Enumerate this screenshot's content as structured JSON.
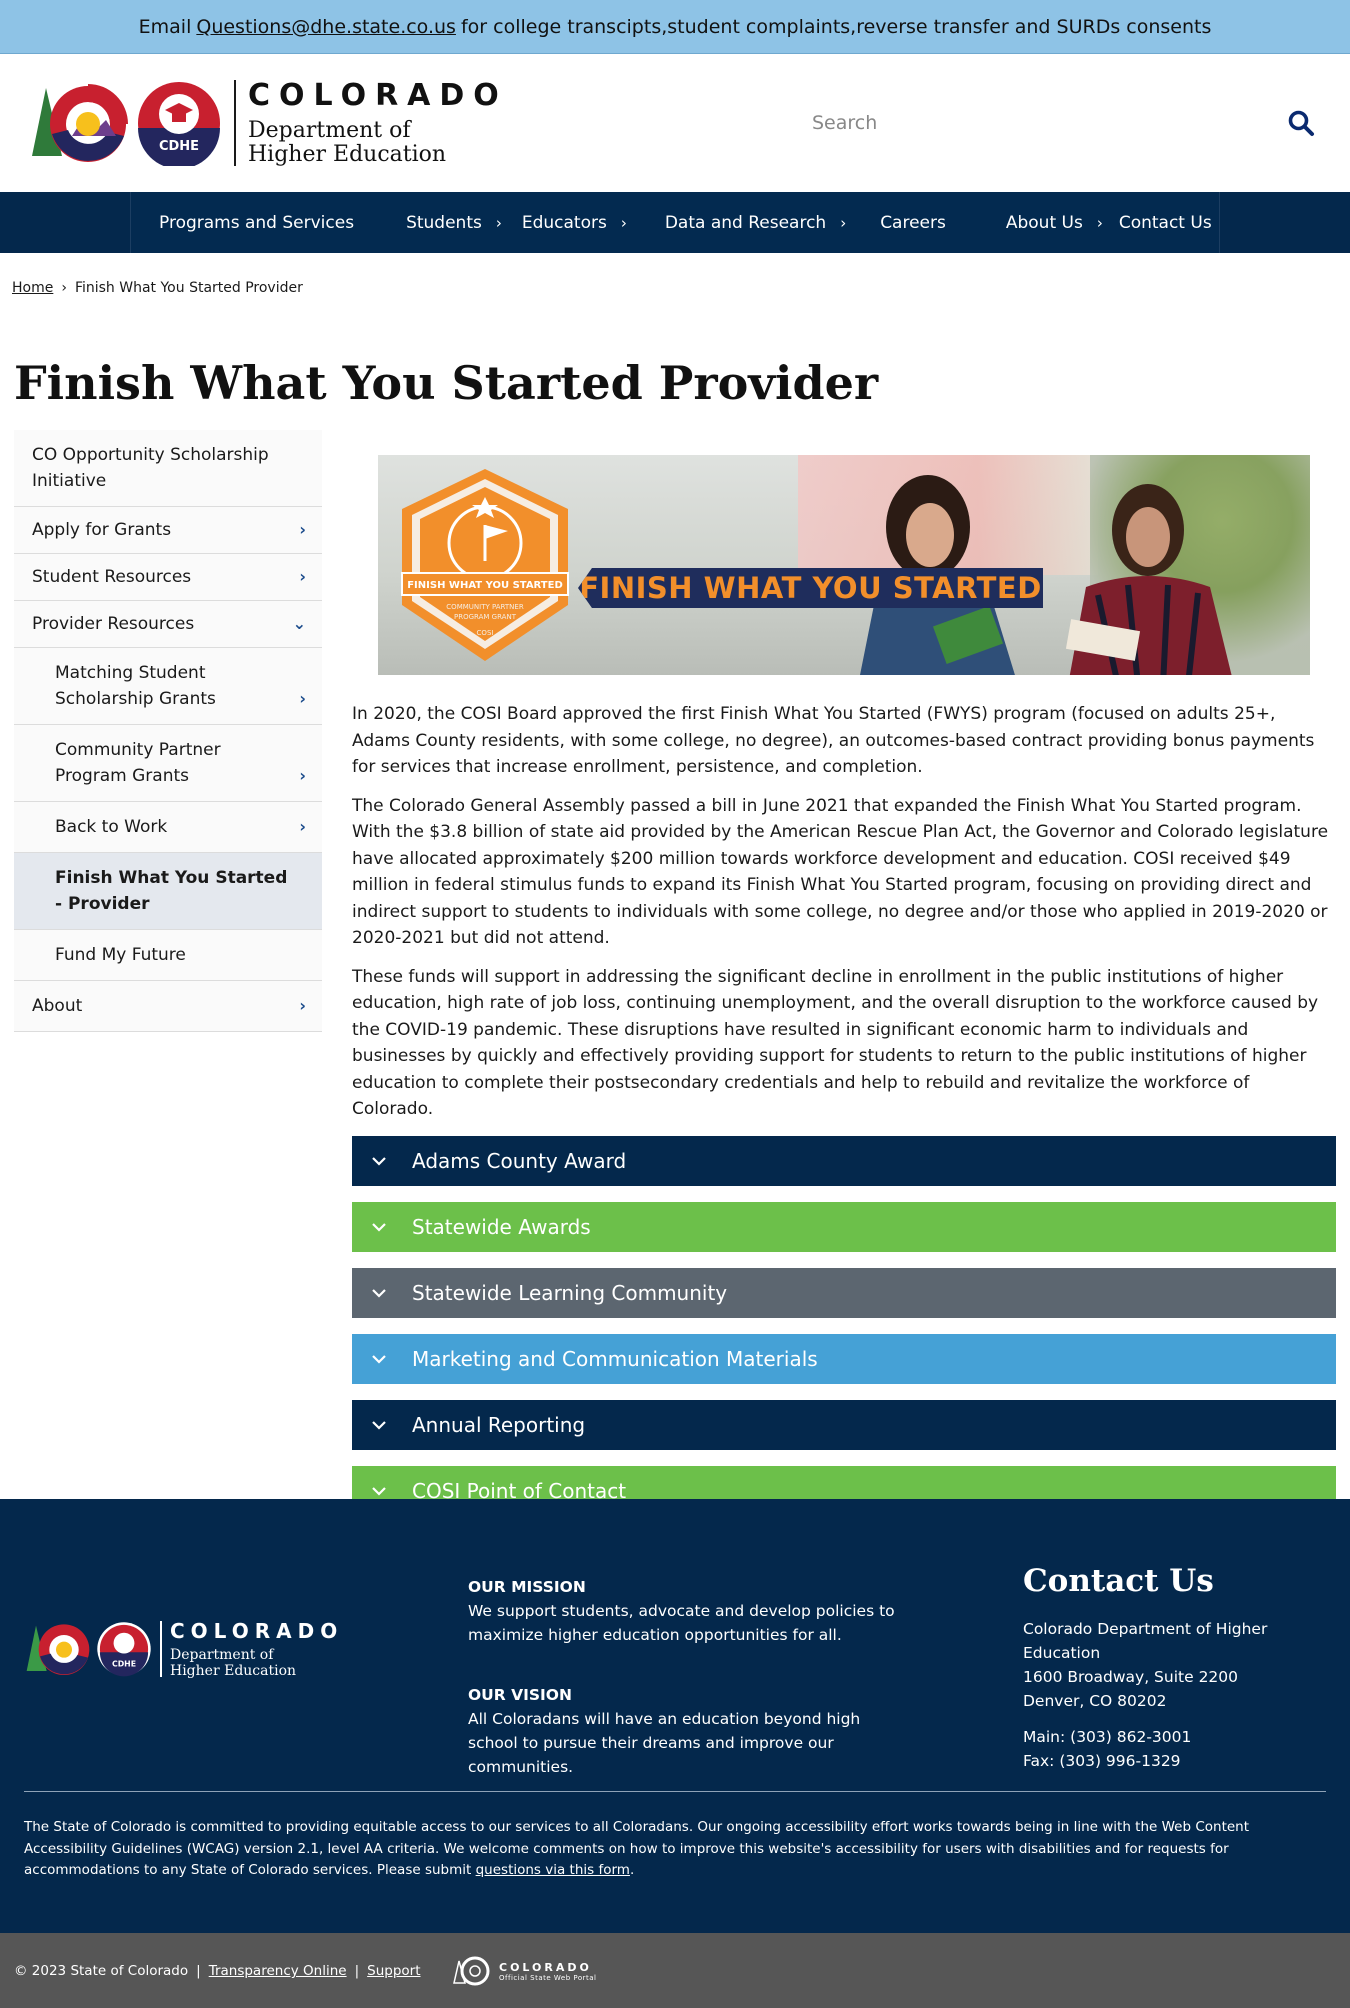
{
  "alert": {
    "prefix": "Email ",
    "link": "Questions@dhe.state.co.us",
    "suffix": " for college transcipts,student complaints,reverse transfer and SURDs consents"
  },
  "header": {
    "logo_state": "COLORADO",
    "logo_dept_line1": "Department of",
    "logo_dept_line2": "Higher Education",
    "logo_badge": "CDHE",
    "search_placeholder": "Search",
    "colors": {
      "brand_navy": "#04284c",
      "alert_bg": "#8ec3e6"
    }
  },
  "nav": {
    "items": [
      {
        "label": "Programs and Services",
        "has_chevron": false
      },
      {
        "label": "Students",
        "has_chevron": true
      },
      {
        "label": "Educators",
        "has_chevron": true
      },
      {
        "label": "Data and Research",
        "has_chevron": true
      },
      {
        "label": "Careers",
        "has_chevron": false
      },
      {
        "label": "About Us",
        "has_chevron": true
      },
      {
        "label": "Contact Us",
        "has_chevron": false
      }
    ]
  },
  "breadcrumb": {
    "home": "Home",
    "separator": "›",
    "current": "Finish What You Started Provider"
  },
  "page_title": "Finish What You Started Provider",
  "sidebar": {
    "items": [
      {
        "label": "CO Opportunity Scholarship Initiative",
        "arrow": ""
      },
      {
        "label": "Apply for Grants",
        "arrow": "›"
      },
      {
        "label": "Student Resources",
        "arrow": "›"
      },
      {
        "label": "Provider Resources",
        "arrow": "⌄"
      },
      {
        "label": "Matching Student Scholarship Grants",
        "arrow": "›"
      },
      {
        "label": "Community Partner Program Grants",
        "arrow": "›"
      },
      {
        "label": "Back to Work",
        "arrow": "›"
      },
      {
        "label": "Finish What You Started - Provider",
        "arrow": ""
      },
      {
        "label": "Fund My Future",
        "arrow": ""
      },
      {
        "label": "About",
        "arrow": "›"
      }
    ]
  },
  "banner": {
    "ribbon_text": "FINISH WHAT YOU STARTED",
    "shield_title": "FINISH WHAT YOU STARTED",
    "shield_sub1": "COMMUNITY PARTNER",
    "shield_sub2": "PROGRAM GRANT",
    "shield_sub3": "COSI",
    "colors": {
      "orange": "#f28f2b",
      "ribbon": "#1f2d5c"
    }
  },
  "content": {
    "p1": "In 2020, the COSI Board approved the first Finish What You Started (FWYS) program (focused on adults 25+, Adams County residents, with some college, no degree), an outcomes-based contract providing bonus payments for services that increase enrollment, persistence, and completion.",
    "p2": "The Colorado General Assembly passed a bill in June 2021 that expanded the Finish What You Started program. With the $3.8 billion of state aid provided by the American Rescue Plan Act, the Governor and Colorado legislature have allocated approximately $200 million towards workforce development and education. COSI received $49 million in federal stimulus funds to expand its Finish What You Started program, focusing on providing direct and indirect support to students to individuals with some college, no degree and/or those who applied in 2019-2020 or 2020-2021 but did not attend.",
    "p3": "These funds will support in addressing the significant decline in enrollment in the public institutions of higher education, high rate of job loss, continuing unemployment, and the overall disruption to the workforce caused by the COVID-19 pandemic.  These disruptions have resulted in significant economic harm to individuals and businesses by quickly and effectively providing support for students to return to the public institutions of higher education to complete their postsecondary credentials and help to rebuild and revitalize the workforce of Colorado."
  },
  "accordions": [
    {
      "label": "Adams County Award",
      "color": "#04284c"
    },
    {
      "label": "Statewide Awards",
      "color": "#6cc04a"
    },
    {
      "label": "Statewide Learning Community",
      "color": "#5c6670"
    },
    {
      "label": "Marketing and Communication Materials",
      "color": "#45a1d6"
    },
    {
      "label": "Annual Reporting",
      "color": "#04284c"
    },
    {
      "label": "COSI Point of Contact",
      "color": "#6cc04a"
    }
  ],
  "footer": {
    "mission_title": "OUR MISSION",
    "mission_text": "We support students, advocate and develop policies to maximize higher education opportunities for all.",
    "vision_title": "OUR VISION",
    "vision_text": "All Coloradans will have an education beyond high school to pursue their dreams and improve our communities.",
    "contact_title": "Contact Us",
    "contact_org": "Colorado Department of Higher Education",
    "contact_addr1": "1600 Broadway, Suite 2200",
    "contact_addr2": "Denver, CO 80202",
    "contact_main": "Main: (303) 862-3001",
    "contact_fax": "Fax: (303) 996-1329",
    "access_text": "The State of Colorado is committed to providing equitable access to our services to all Coloradans. Our ongoing accessibility effort works towards being in line with the Web Content Accessibility Guidelines (WCAG) version 2.1, level AA criteria. We welcome comments on how to improve this website's accessibility for users with disabilities and for requests for accommodations to any State of Colorado services. Please submit ",
    "access_link": "questions via this form",
    "access_end": "."
  },
  "bottombar": {
    "copyright": "© 2023 State of Colorado",
    "link1": "Transparency Online",
    "link2": "Support",
    "sep": "|",
    "portal_state": "COLORADO",
    "portal_sub": "Official State Web Portal"
  }
}
